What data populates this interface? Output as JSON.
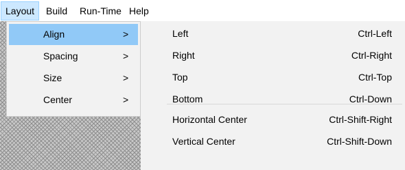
{
  "menubar": {
    "items": [
      {
        "label": "Layout"
      },
      {
        "label": "Build"
      },
      {
        "label": "Run-Time"
      },
      {
        "label": "Help"
      }
    ]
  },
  "layout_menu": {
    "items": [
      {
        "label": "Align",
        "arrow": ">"
      },
      {
        "label": "Spacing",
        "arrow": ">"
      },
      {
        "label": "Size",
        "arrow": ">"
      },
      {
        "label": "Center",
        "arrow": ">"
      }
    ]
  },
  "align_submenu": {
    "items": [
      {
        "label": "Left",
        "shortcut": "Ctrl-Left"
      },
      {
        "label": "Right",
        "shortcut": "Ctrl-Right"
      },
      {
        "label": "Top",
        "shortcut": "Ctrl-Top"
      },
      {
        "label": "Bottom",
        "shortcut": "Ctrl-Down"
      },
      {
        "label": "Horizontal Center",
        "shortcut": "Ctrl-Shift-Right"
      },
      {
        "label": "Vertical Center",
        "shortcut": "Ctrl-Shift-Down"
      }
    ]
  },
  "colors": {
    "menubar_active": "#cce8ff",
    "item_highlight": "#91c9f7",
    "menu_bg": "#f2f2f2"
  }
}
